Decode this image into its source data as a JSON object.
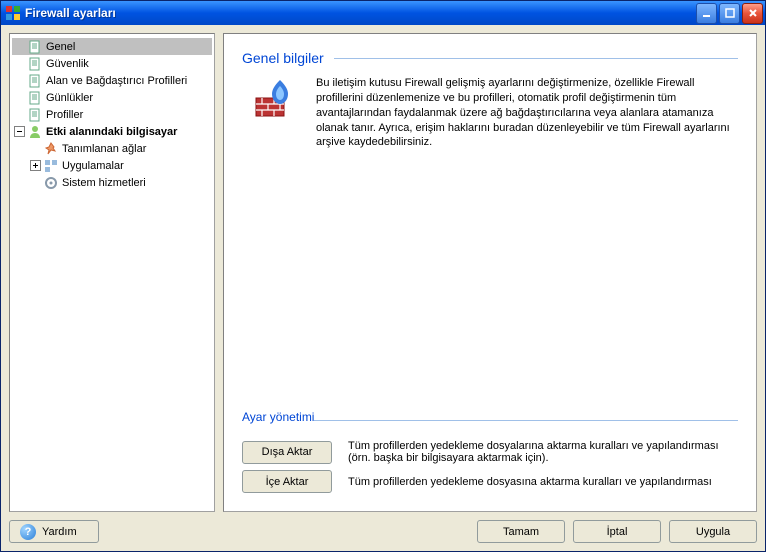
{
  "window": {
    "title": "Firewall ayarları"
  },
  "tree": {
    "genel": "Genel",
    "guvenlik": "Güvenlik",
    "alan": "Alan ve Bağdaştırıcı Profilleri",
    "gunlukler": "Günlükler",
    "profiller": "Profiller",
    "etki": "Etki alanındaki bilgisayar",
    "tanimlanan": "Tanımlanan ağlar",
    "uygulamalar": "Uygulamalar",
    "sistem": "Sistem hizmetleri"
  },
  "detail": {
    "heading": "Genel bilgiler",
    "paragraph": "Bu iletişim kutusu Firewall gelişmiş ayarlarını değiştirmenize, özellikle Firewall profillerini düzenlemenize ve bu profilleri, otomatik profil değiştirmenin tüm avantajlarından faydalanmak üzere ağ bağdaştırıcılarına veya alanlara atamanıza olanak tanır. Ayrıca, erişim haklarını buradan düzenleyebilir ve tüm Firewall ayarlarını arşive kaydedebilirsiniz.",
    "mgmt_heading": "Ayar yönetimi",
    "export_btn": "Dışa Aktar",
    "export_desc": "Tüm profillerden yedekleme dosyalarına aktarma kuralları ve yapılandırması (örn. başka bir bilgisayara aktarmak için).",
    "import_btn": "İçe Aktar",
    "import_desc": "Tüm profillerden yedekleme dosyasına aktarma kuralları ve yapılandırması"
  },
  "buttons": {
    "help": "Yardım",
    "ok": "Tamam",
    "cancel": "İptal",
    "apply": "Uygula"
  }
}
